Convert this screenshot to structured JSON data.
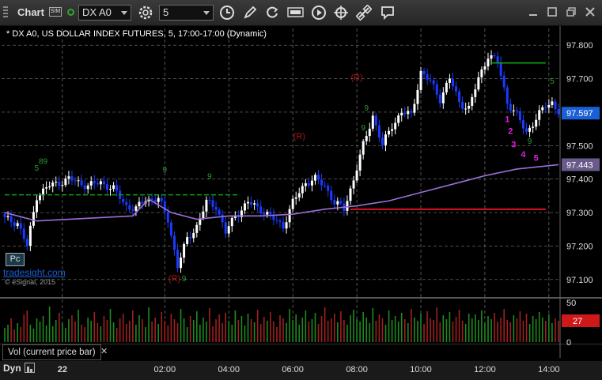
{
  "toolbar": {
    "title": "Chart",
    "sim_badge": "SIM",
    "symbol": "DX A0",
    "interval": "5"
  },
  "series_title": "* DX A0, US DOLLAR INDEX FUTURES, 5, 17:00-17:00 (Dynamic)",
  "watermark": "tradesight.com",
  "copyright": "© eSignal, 2015",
  "pc_button": "Pc",
  "volume_panel_label": "Vol (current price bar)",
  "close_glyph": "✕",
  "bottom_label": "Dyn",
  "colors": {
    "background": "#000000",
    "up_candle": "#ffffff",
    "down_candle": "#1a3aff",
    "ma_line": "#9b6fd6",
    "green_line": "#12a012",
    "red_line": "#e01020",
    "vol_up": "#1f8a1f",
    "vol_down": "#a02020",
    "price_badge": "#1a5fd6",
    "ma_badge": "#6a5a8a",
    "vol_badge": "#d01818",
    "magenta": "#e020e0"
  },
  "chart_data": {
    "type": "candlestick",
    "y_axis": {
      "min": 97.05,
      "max": 97.85,
      "ticks": [
        "97.800",
        "97.700",
        "97.600",
        "97.500",
        "97.400",
        "97.300",
        "97.200",
        "97.100"
      ],
      "tick_values": [
        97.8,
        97.7,
        97.6,
        97.5,
        97.4,
        97.3,
        97.2,
        97.1
      ]
    },
    "x_axis": {
      "labels": [
        "22",
        "02:00",
        "04:00",
        "06:00",
        "08:00",
        "10:00",
        "12:00",
        "14:00"
      ],
      "label_bar_index": [
        18,
        50,
        70,
        90,
        110,
        130,
        150,
        170
      ]
    },
    "bars_count": 174,
    "anchors": [
      [
        0,
        97.28
      ],
      [
        4,
        97.27
      ],
      [
        7,
        97.2
      ],
      [
        10,
        97.35
      ],
      [
        14,
        97.38
      ],
      [
        20,
        97.4
      ],
      [
        26,
        97.38
      ],
      [
        30,
        97.39
      ],
      [
        34,
        97.37
      ],
      [
        38,
        97.32
      ],
      [
        41,
        97.31
      ],
      [
        44,
        97.34
      ],
      [
        48,
        97.34
      ],
      [
        51,
        97.28
      ],
      [
        54,
        97.14
      ],
      [
        57,
        97.22
      ],
      [
        60,
        97.26
      ],
      [
        63,
        97.33
      ],
      [
        66,
        97.32
      ],
      [
        69,
        97.24
      ],
      [
        72,
        97.29
      ],
      [
        76,
        97.33
      ],
      [
        80,
        97.31
      ],
      [
        84,
        97.28
      ],
      [
        87,
        97.26
      ],
      [
        90,
        97.33
      ],
      [
        94,
        97.39
      ],
      [
        97,
        97.4
      ],
      [
        100,
        97.38
      ],
      [
        103,
        97.33
      ],
      [
        106,
        97.31
      ],
      [
        109,
        97.4
      ],
      [
        112,
        97.5
      ],
      [
        115,
        97.59
      ],
      [
        118,
        97.5
      ],
      [
        121,
        97.56
      ],
      [
        124,
        97.6
      ],
      [
        127,
        97.59
      ],
      [
        130,
        97.72
      ],
      [
        133,
        97.69
      ],
      [
        136,
        97.64
      ],
      [
        139,
        97.7
      ],
      [
        142,
        97.63
      ],
      [
        145,
        97.61
      ],
      [
        148,
        97.7
      ],
      [
        151,
        97.77
      ],
      [
        154,
        97.75
      ],
      [
        157,
        97.63
      ],
      [
        160,
        97.59
      ],
      [
        163,
        97.54
      ],
      [
        166,
        97.58
      ],
      [
        169,
        97.62
      ],
      [
        171,
        97.63
      ],
      [
        173,
        97.6
      ]
    ],
    "moving_average": {
      "name": "MA",
      "values": [
        [
          0,
          97.3
        ],
        [
          10,
          97.275
        ],
        [
          20,
          97.28
        ],
        [
          30,
          97.285
        ],
        [
          40,
          97.29
        ],
        [
          45,
          97.34
        ],
        [
          52,
          97.3
        ],
        [
          60,
          97.28
        ],
        [
          70,
          97.29
        ],
        [
          80,
          97.29
        ],
        [
          90,
          97.295
        ],
        [
          100,
          97.31
        ],
        [
          110,
          97.32
        ],
        [
          120,
          97.335
        ],
        [
          130,
          97.36
        ],
        [
          140,
          97.385
        ],
        [
          150,
          97.41
        ],
        [
          160,
          97.43
        ],
        [
          173,
          97.443
        ]
      ],
      "last_value": "97.443"
    },
    "current_price": "97.597",
    "green_dashed_level": {
      "value": 97.353,
      "from_bar": 0,
      "to_bar": 73
    },
    "green_level": {
      "value": 97.747,
      "from_bar": 152,
      "to_bar": 169
    },
    "red_level": {
      "value": 97.31,
      "from_bar": 108,
      "to_bar": 169
    },
    "r_markers": [
      {
        "label": "(R)",
        "bar": 110,
        "y": 97.695
      },
      {
        "label": "(R)",
        "bar": 92,
        "y": 97.52
      },
      {
        "label": "(R)",
        "bar": 53,
        "y": 97.095
      }
    ],
    "count_labels": [
      {
        "label": "1",
        "bar": 157,
        "y": 97.57
      },
      {
        "label": "2",
        "bar": 158,
        "y": 97.535
      },
      {
        "label": "3",
        "bar": 159,
        "y": 97.495
      },
      {
        "label": "4",
        "bar": 162,
        "y": 97.465
      },
      {
        "label": "5",
        "bar": 166,
        "y": 97.455
      }
    ],
    "setup_labels": [
      {
        "label": "89",
        "bar": 12,
        "y": 97.445
      },
      {
        "label": "5",
        "bar": 10,
        "y": 97.425
      },
      {
        "label": "9",
        "bar": 50,
        "y": 97.42
      },
      {
        "label": "9",
        "bar": 64,
        "y": 97.4
      },
      {
        "label": "9",
        "bar": 113,
        "y": 97.605
      },
      {
        "label": "9",
        "bar": 112,
        "y": 97.545
      },
      {
        "label": "9",
        "bar": 56,
        "y": 97.095
      },
      {
        "label": "5",
        "bar": 171,
        "y": 97.685
      },
      {
        "label": "9",
        "bar": 164,
        "y": 97.505
      }
    ],
    "volume": {
      "ticks": [
        "50",
        "0"
      ],
      "tick_values": [
        50,
        0
      ],
      "max": 55,
      "current": "27",
      "values": [
        18,
        22,
        30,
        16,
        24,
        19,
        35,
        40,
        22,
        17,
        30,
        26,
        33,
        21,
        45,
        20,
        28,
        37,
        24,
        18,
        29,
        34,
        26,
        41,
        22,
        19,
        31,
        27,
        38,
        24,
        20,
        33,
        28,
        42,
        25,
        18,
        30,
        36,
        23,
        27,
        40,
        22,
        34,
        29,
        19,
        44,
        26,
        31,
        23,
        38,
        27,
        21,
        36,
        29,
        24,
        42,
        30,
        19,
        33,
        28,
        39,
        22,
        31,
        26,
        43,
        20,
        29,
        35,
        24,
        37,
        27,
        22,
        40,
        28,
        33,
        21,
        36,
        29,
        25,
        41,
        23,
        32,
        27,
        38,
        26,
        19,
        34,
        30,
        24,
        42,
        28,
        35,
        22,
        31,
        40,
        26,
        29,
        37,
        23,
        33,
        44,
        27,
        30,
        36,
        25,
        39,
        28,
        22,
        34,
        41,
        29,
        26,
        38,
        31,
        24,
        43,
        27,
        35,
        30,
        22,
        40,
        28,
        33,
        26,
        37,
        29,
        24,
        42,
        31,
        27,
        36,
        23,
        39,
        30,
        28,
        44,
        25,
        34,
        29,
        38,
        26,
        32,
        41,
        27,
        23,
        36,
        30,
        35,
        28,
        40,
        24,
        33,
        29,
        37,
        26,
        31,
        42,
        28,
        25,
        34,
        30,
        39,
        27,
        36,
        23,
        33,
        29,
        38,
        31,
        27,
        35,
        24,
        30,
        27
      ],
      "up_flags_seed": 7
    }
  }
}
